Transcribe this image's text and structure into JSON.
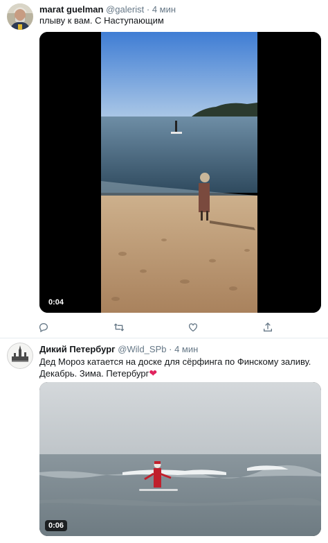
{
  "tweets": [
    {
      "name": "marat guelman",
      "handle": "@galerist",
      "separator": "·",
      "time": "4 мин",
      "text": "плыву к вам. С Наступающим",
      "video_duration": "0:04"
    },
    {
      "name": "Дикий Петербург",
      "handle": "@Wild_SPb",
      "separator": "·",
      "time": "4 мин",
      "text_line1": "Дед Мороз катается на доске для сёрфинга по Финскому заливу.",
      "text_line2": "Декабрь. Зима. Петербург",
      "heart": "❤",
      "video_duration": "0:06"
    }
  ],
  "colors": {
    "secondary_text": "#657786",
    "icon": "#657786",
    "divider": "#e6ecf0",
    "heart": "#e0245e"
  },
  "icons": [
    "reply-icon",
    "retweet-icon",
    "like-icon",
    "share-icon"
  ]
}
